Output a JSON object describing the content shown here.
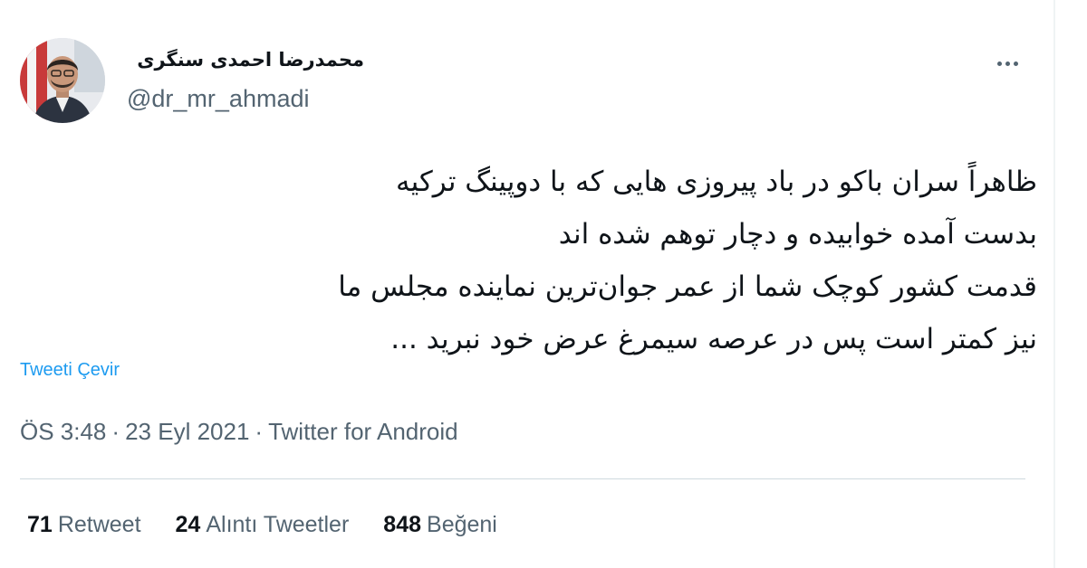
{
  "user": {
    "display_name": "محمدرضا احمدی سنگری",
    "handle": "@dr_mr_ahmadi"
  },
  "tweet": {
    "lines": [
      "ظاهراً سران باکو در باد پیروزی هایی که با دوپینگ ترکیه",
      "بدست آمده خوابیده و دچار توهم شده اند",
      "قدمت کشور کوچک شما از عمر جوان‌ترین نماینده مجلس ما",
      "نیز کمتر است پس در عرصه سیمرغ عرض خود نبرید ..."
    ],
    "translate_label": "Tweeti Çevir"
  },
  "meta": {
    "time": "ÖS 3:48",
    "date": "23 Eyl 2021",
    "separator": "·",
    "source": "Twitter for Android"
  },
  "stats": {
    "retweets": {
      "count": "71",
      "label": "Retweet"
    },
    "quotes": {
      "count": "24",
      "label": "Alıntı Tweetler"
    },
    "likes": {
      "count": "848",
      "label": "Beğeni"
    }
  },
  "icons": {
    "more": "more-horizontal-icon"
  },
  "colors": {
    "text": "#0f1419",
    "secondary": "#536471",
    "link": "#1d9bf0",
    "divider": "#cfd9de"
  }
}
